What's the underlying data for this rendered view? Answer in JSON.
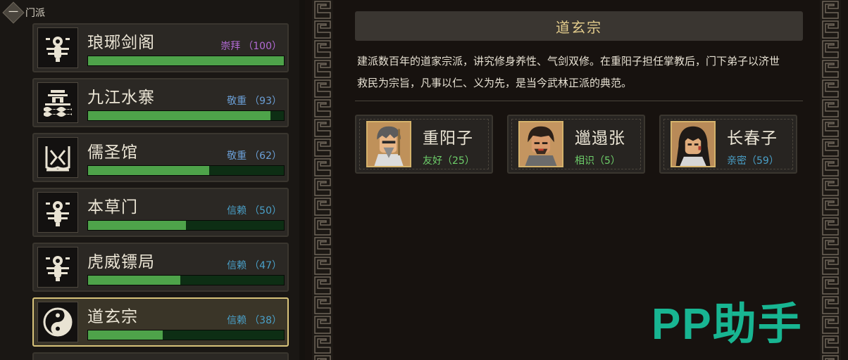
{
  "tree": {
    "title": "门派",
    "collapse_symbol": "一"
  },
  "factions": [
    {
      "name": "琅琊剑阁",
      "relation": "崇拜",
      "value": "（100）",
      "progress": 1.0,
      "relation_color": "#b36bd6",
      "icon": "scorpion-emblem-icon"
    },
    {
      "name": "九江水寨",
      "relation": "敬重",
      "value": "（93）",
      "progress": 0.93,
      "relation_color": "#6b9fd6",
      "icon": "water-fortress-emblem-icon"
    },
    {
      "name": "儒圣馆",
      "relation": "敬重",
      "value": "（62）",
      "progress": 0.62,
      "relation_color": "#6b9fd6",
      "icon": "scholar-hall-emblem-icon"
    },
    {
      "name": "本草门",
      "relation": "信赖",
      "value": "（50）",
      "progress": 0.5,
      "relation_color": "#4aa0c8",
      "icon": "scorpion-emblem-icon"
    },
    {
      "name": "虎威镖局",
      "relation": "信赖",
      "value": "（47）",
      "progress": 0.47,
      "relation_color": "#4aa0c8",
      "icon": "scorpion-emblem-icon"
    },
    {
      "name": "道玄宗",
      "relation": "信赖",
      "value": "（38）",
      "progress": 0.38,
      "relation_color": "#4aa0c8",
      "icon": "taiji-emblem-icon",
      "selected": true
    }
  ],
  "detail": {
    "title": "道玄宗",
    "description_line1": "建派数百年的道家宗派，讲究修身养性、气剑双修。在重阳子担任掌教后，门下弟子以济世",
    "description_line2": "救民为宗旨，凡事以仁、义为先，是当今武林正派的典范。",
    "characters": [
      {
        "name": "重阳子",
        "relation": "友好",
        "value": "（25）",
        "relation_color": "#6ecf6a"
      },
      {
        "name": "邋遢张",
        "relation": "相识",
        "value": "（5）",
        "relation_color": "#6ecf6a"
      },
      {
        "name": "长春子",
        "relation": "亲密",
        "value": "（59）",
        "relation_color": "#4aa0c8"
      }
    ]
  },
  "watermark": "PP助手"
}
